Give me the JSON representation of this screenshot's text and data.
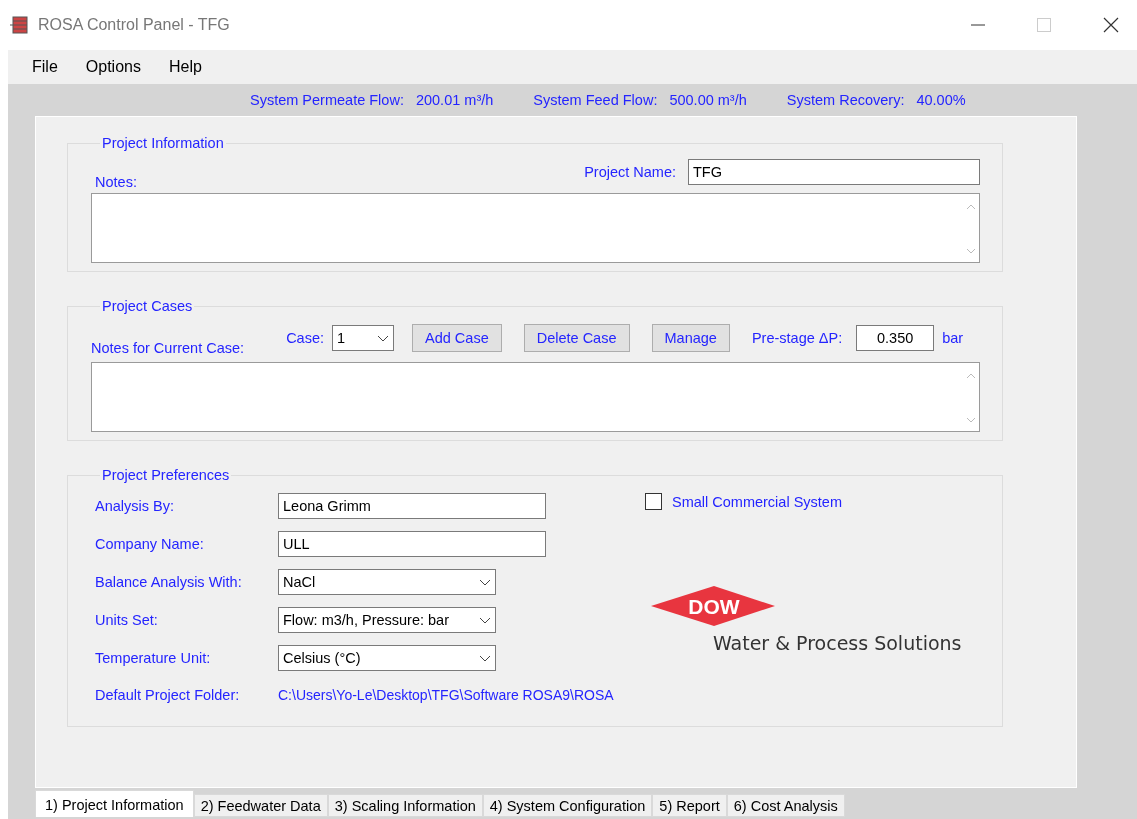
{
  "window": {
    "title": "ROSA Control Panel - TFG"
  },
  "menu": [
    "File",
    "Options",
    "Help"
  ],
  "status": [
    {
      "label": "System Permeate Flow:",
      "value": "200.01 m³/h"
    },
    {
      "label": "System Feed Flow:",
      "value": "500.00 m³/h"
    },
    {
      "label": "System Recovery:",
      "value": "40.00%"
    }
  ],
  "project_information": {
    "legend": "Project Information",
    "notes_label": "Notes:",
    "name_label": "Project Name:",
    "name_value": "TFG"
  },
  "project_cases": {
    "legend": "Project Cases",
    "notes_label": "Notes for Current Case:",
    "case_label": "Case:",
    "case_value": "1",
    "buttons": [
      "Add Case",
      "Delete Case",
      "Manage"
    ],
    "prestage_label": "Pre-stage ΔP:",
    "prestage_value": "0.350",
    "prestage_unit": "bar"
  },
  "preferences": {
    "legend": "Project Preferences",
    "fields": [
      {
        "label": "Analysis By:",
        "value": "Leona Grimm",
        "kind": "text"
      },
      {
        "label": "Company Name:",
        "value": "ULL",
        "kind": "text"
      },
      {
        "label": "Balance Analysis With:",
        "value": "NaCl",
        "kind": "select"
      },
      {
        "label": "Units Set:",
        "value": "Flow: m3/h, Pressure: bar",
        "kind": "select"
      },
      {
        "label": "Temperature Unit:",
        "value": "Celsius (°C)",
        "kind": "select"
      }
    ],
    "folder_label": "Default Project Folder:",
    "folder_value": "C:\\Users\\Yo-Le\\Desktop\\TFG\\Software ROSA9\\ROSA",
    "checkbox": {
      "label": "Small Commercial System",
      "checked": false
    },
    "logo": {
      "brand": "DOW",
      "tagline": "Water & Process Solutions"
    }
  },
  "tabs": [
    {
      "label": "1) Project Information",
      "selected": true
    },
    {
      "label": "2) Feedwater Data",
      "selected": false
    },
    {
      "label": "3) Scaling Information",
      "selected": false
    },
    {
      "label": "4) System Configuration",
      "selected": false
    },
    {
      "label": "5) Report",
      "selected": false
    },
    {
      "label": "6) Cost Analysis",
      "selected": false
    }
  ]
}
